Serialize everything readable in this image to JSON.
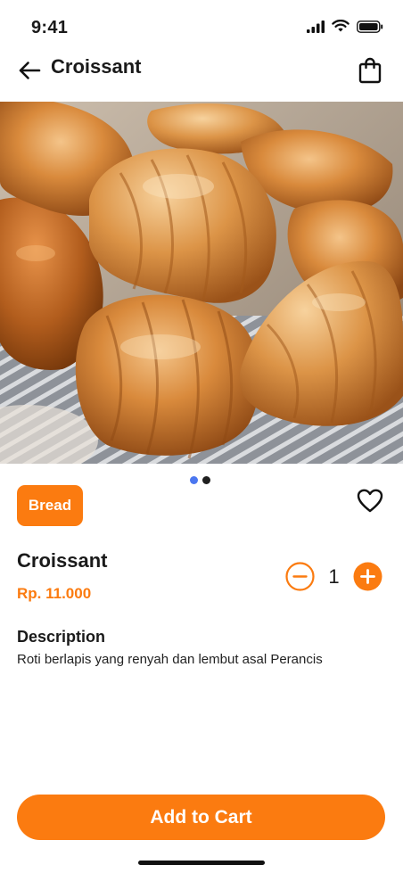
{
  "status_bar": {
    "time": "9:41"
  },
  "header": {
    "title": "Croissant"
  },
  "carousel": {
    "dots": 2,
    "active_index": 0
  },
  "product": {
    "category": "Bread",
    "name": "Croissant",
    "price": "Rp. 11.000",
    "quantity": "1",
    "description_title": "Description",
    "description": "Roti berlapis yang renyah dan lembut asal Perancis"
  },
  "actions": {
    "add_to_cart": "Add to Cart"
  },
  "icons": {
    "back": "arrow-left-icon",
    "bag": "shopping-bag-icon",
    "favorite": "heart-icon",
    "minus": "minus-circle-icon",
    "plus": "plus-circle-icon"
  },
  "colors": {
    "accent": "#fb7b10",
    "dot_active": "#4b77f0",
    "text": "#1a1a1a"
  }
}
